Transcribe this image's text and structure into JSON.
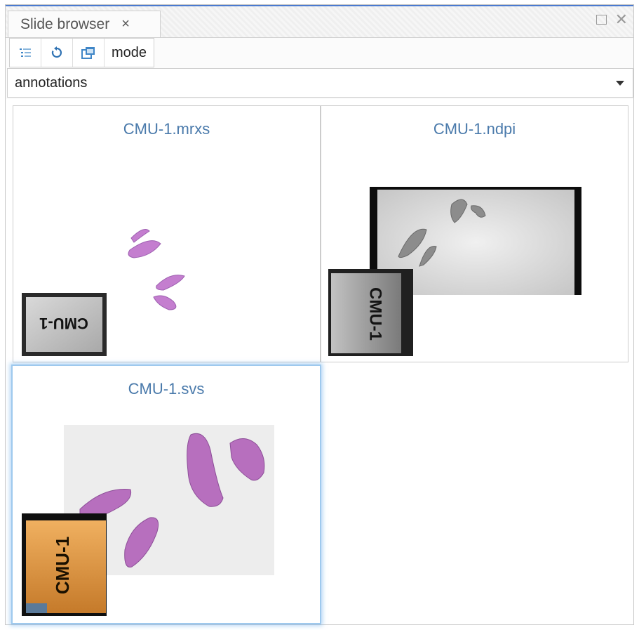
{
  "tab": {
    "title": "Slide browser",
    "close_glyph": "×"
  },
  "window": {
    "maximize_icon": "maximize-icon",
    "close_glyph": "✕"
  },
  "toolbar": {
    "mode_label": "mode",
    "icons": [
      "tree-list-icon",
      "refresh-icon",
      "open-window-icon"
    ]
  },
  "dropdown": {
    "value": "annotations"
  },
  "slides": [
    {
      "name": "CMU-1.mrxs",
      "label_text": "CMU-1",
      "selected": false
    },
    {
      "name": "CMU-1.ndpi",
      "label_text": "CMU-1",
      "selected": false
    },
    {
      "name": "CMU-1.svs",
      "label_text": "CMU-1",
      "selected": true
    }
  ],
  "colors": {
    "accent": "#4a7ad0",
    "title": "#4a7aab",
    "tissue": "#c07ac8",
    "selection": "#9ec9ee"
  }
}
